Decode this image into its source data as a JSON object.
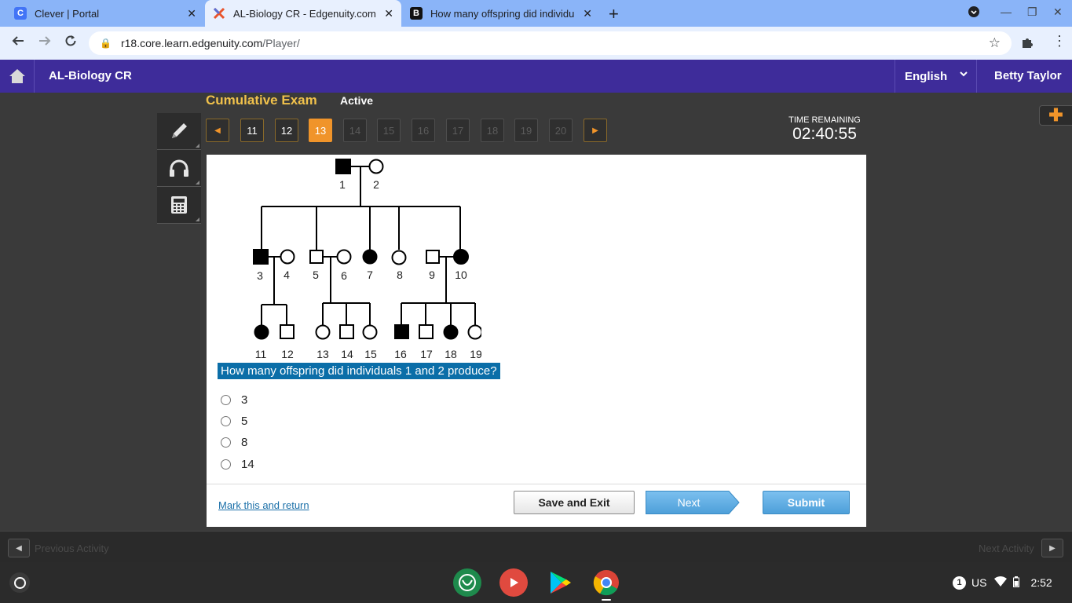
{
  "browser": {
    "tabs": [
      {
        "title": "Clever | Portal",
        "favicon": "C",
        "favicon_color": "#4274f6"
      },
      {
        "title": "AL-Biology CR - Edgenuity.com",
        "favicon": "X",
        "favicon_color": "#e8542c"
      },
      {
        "title": "How many offspring did individu",
        "favicon": "B",
        "favicon_color": "#111111"
      }
    ],
    "url_host": "r18.core.learn.edgenuity.com",
    "url_path": "/Player/"
  },
  "app": {
    "course_title": "AL-Biology CR",
    "language": "English",
    "user_name": "Betty Taylor"
  },
  "exam": {
    "title": "Cumulative Exam",
    "status": "Active",
    "questions": [
      {
        "num": "11",
        "state": "answered"
      },
      {
        "num": "12",
        "state": "answered"
      },
      {
        "num": "13",
        "state": "current"
      },
      {
        "num": "14",
        "state": "locked"
      },
      {
        "num": "15",
        "state": "locked"
      },
      {
        "num": "16",
        "state": "locked"
      },
      {
        "num": "17",
        "state": "locked"
      },
      {
        "num": "18",
        "state": "locked"
      },
      {
        "num": "19",
        "state": "locked"
      },
      {
        "num": "20",
        "state": "locked"
      }
    ],
    "time_label": "TIME REMAINING",
    "time_value": "02:40:55"
  },
  "pedigree": {
    "labels": [
      "1",
      "2",
      "3",
      "4",
      "5",
      "6",
      "7",
      "8",
      "9",
      "10",
      "11",
      "12",
      "13",
      "14",
      "15",
      "16",
      "17",
      "18",
      "19"
    ]
  },
  "question": {
    "text": "How many offspring did individuals 1 and 2 produce?",
    "options": [
      "3",
      "5",
      "8",
      "14"
    ]
  },
  "footer": {
    "mark_label": "Mark this and return",
    "save_label": "Save and Exit",
    "next_label": "Next",
    "submit_label": "Submit"
  },
  "activity": {
    "prev_label": "Previous Activity",
    "next_label": "Next Activity"
  },
  "system": {
    "locale": "US",
    "notification_count": "1",
    "clock": "2:52"
  },
  "colors": {
    "header_bg": "#3e2c9a",
    "accent_orange": "#f0942a",
    "exam_title": "#f0c14b",
    "question_highlight": "#0b6ea8"
  }
}
